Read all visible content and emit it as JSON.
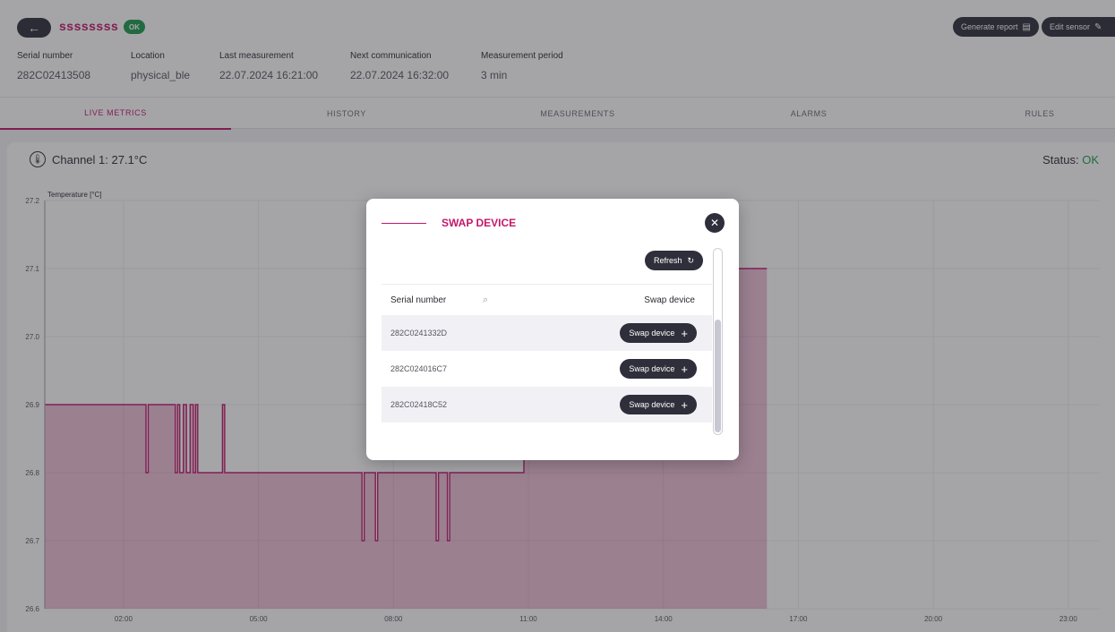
{
  "header": {
    "back_icon": "arrow-left-icon",
    "sensor_name": "ssssssss",
    "status_badge": "OK",
    "generate_report_label": "Generate report",
    "edit_sensor_label": "Edit sensor",
    "meta": [
      {
        "label": "Serial number",
        "value": "282C02413508"
      },
      {
        "label": "Location",
        "value": "physical_ble"
      },
      {
        "label": "Last measurement",
        "value": "22.07.2024 16:21:00"
      },
      {
        "label": "Next communication",
        "value": "22.07.2024 16:32:00"
      },
      {
        "label": "Measurement period",
        "value": "3 min"
      }
    ]
  },
  "tabs": [
    "LIVE METRICS",
    "HISTORY",
    "MEASUREMENTS",
    "ALARMS",
    "RULES"
  ],
  "active_tab": "LIVE METRICS",
  "channel": {
    "title": "Channel 1: 27.1°C",
    "status_label": "Status:",
    "status_value": "OK"
  },
  "chart_data": {
    "type": "area",
    "ylabel": "Temperature [°C]",
    "ylim": [
      26.6,
      27.2
    ],
    "yticks": [
      "27.2",
      "27.1",
      "27.0",
      "26.9",
      "26.8",
      "26.7",
      "26.6"
    ],
    "xticks": [
      "02:00",
      "05:00",
      "08:00",
      "11:00",
      "14:00",
      "17:00",
      "20:00",
      "23:00"
    ],
    "xlim_hours": [
      0.25,
      23.7
    ],
    "series": [
      {
        "points": [
          [
            0.25,
            26.9
          ],
          [
            2.5,
            26.9
          ],
          [
            2.5,
            26.8
          ],
          [
            2.55,
            26.8
          ],
          [
            2.55,
            26.9
          ],
          [
            3.15,
            26.9
          ],
          [
            3.15,
            26.8
          ],
          [
            3.2,
            26.8
          ],
          [
            3.2,
            26.9
          ],
          [
            3.25,
            26.9
          ],
          [
            3.25,
            26.8
          ],
          [
            3.33,
            26.8
          ],
          [
            3.33,
            26.9
          ],
          [
            3.4,
            26.9
          ],
          [
            3.4,
            26.8
          ],
          [
            3.48,
            26.8
          ],
          [
            3.48,
            26.9
          ],
          [
            3.55,
            26.9
          ],
          [
            3.55,
            26.8
          ],
          [
            3.6,
            26.8
          ],
          [
            3.6,
            26.9
          ],
          [
            3.65,
            26.9
          ],
          [
            3.65,
            26.8
          ],
          [
            4.2,
            26.8
          ],
          [
            4.2,
            26.9
          ],
          [
            4.25,
            26.9
          ],
          [
            4.25,
            26.8
          ],
          [
            7.3,
            26.8
          ],
          [
            7.3,
            26.7
          ],
          [
            7.35,
            26.7
          ],
          [
            7.35,
            26.8
          ],
          [
            7.6,
            26.8
          ],
          [
            7.6,
            26.7
          ],
          [
            7.65,
            26.7
          ],
          [
            7.65,
            26.8
          ],
          [
            8.95,
            26.8
          ],
          [
            8.95,
            26.7
          ],
          [
            9.0,
            26.7
          ],
          [
            9.0,
            26.8
          ],
          [
            9.2,
            26.8
          ],
          [
            9.2,
            26.7
          ],
          [
            9.25,
            26.7
          ],
          [
            9.25,
            26.8
          ],
          [
            10.9,
            26.8
          ],
          [
            10.9,
            27.1
          ],
          [
            16.3,
            27.1
          ]
        ]
      }
    ]
  },
  "modal": {
    "title": "SWAP DEVICE",
    "close_icon": "close-icon",
    "refresh_label": "Refresh",
    "col_serial": "Serial number",
    "col_swap": "Swap device",
    "rows": [
      {
        "serial": "282C0241332D",
        "action": "Swap device"
      },
      {
        "serial": "282C024016C7",
        "action": "Swap device"
      },
      {
        "serial": "282C02418C52",
        "action": "Swap device"
      }
    ]
  },
  "colors": {
    "accent": "#c2186b",
    "dark": "#2f2f3b",
    "ok": "#1e9b4d"
  }
}
